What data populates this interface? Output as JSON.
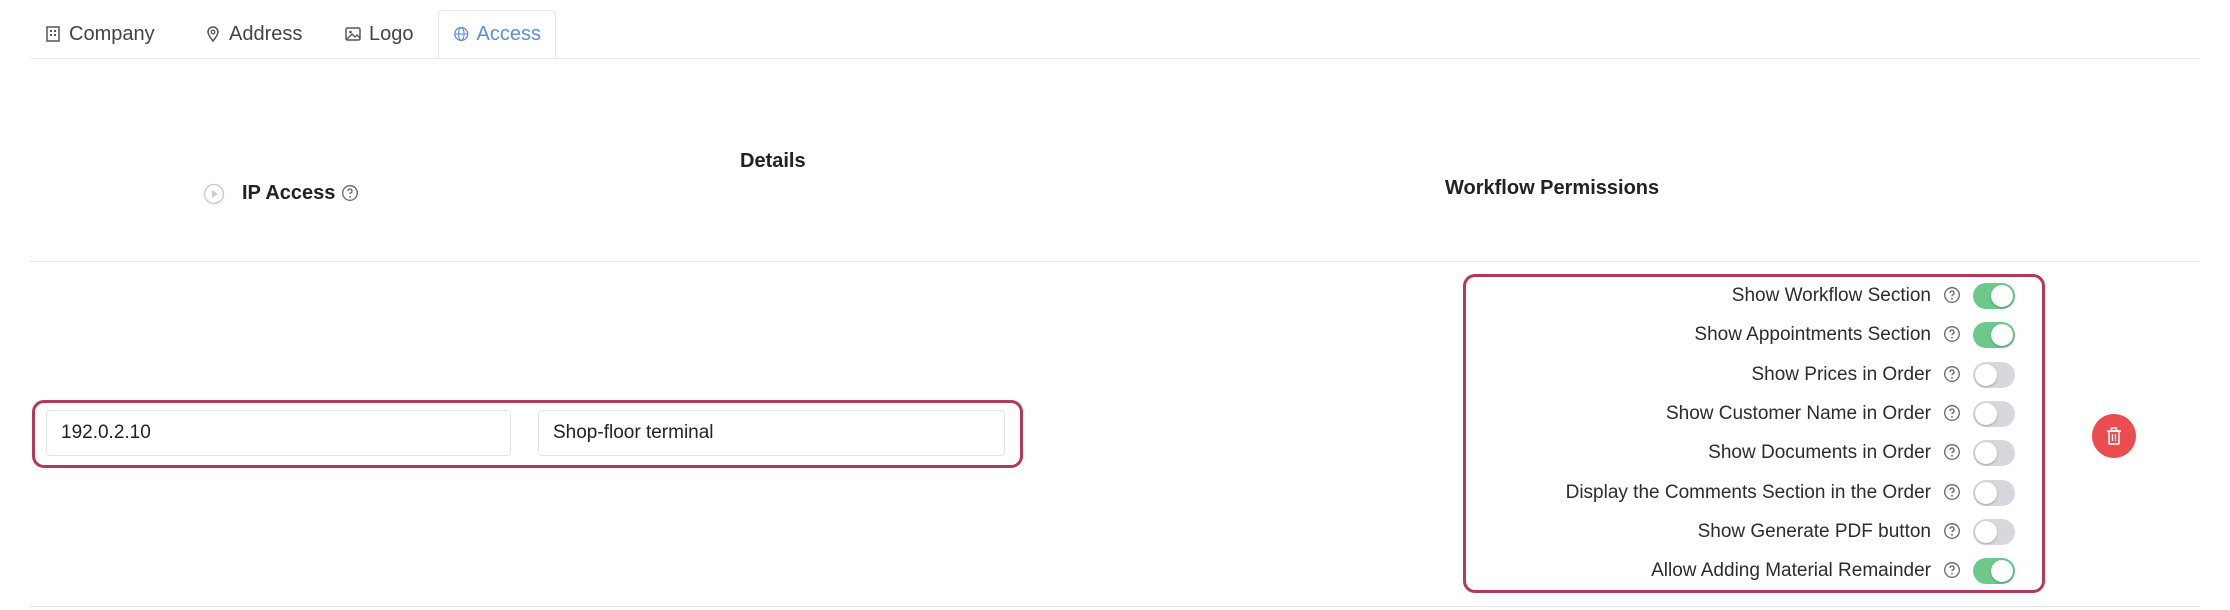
{
  "tabs": [
    {
      "label": "Company",
      "icon": "building-icon",
      "active": false
    },
    {
      "label": "Address",
      "icon": "map-pin-icon",
      "active": false
    },
    {
      "label": "Logo",
      "icon": "image-icon",
      "active": false
    },
    {
      "label": "Access",
      "icon": "globe-icon",
      "active": true
    }
  ],
  "table_header": {
    "details": "Details",
    "ip_access": "IP Access",
    "workflow_permissions": "Workflow Permissions"
  },
  "row": {
    "ip_value": "192.0.2.10",
    "details_value": "Shop-floor terminal",
    "permissions": [
      {
        "label": "Show Workflow Section",
        "enabled": true
      },
      {
        "label": "Show Appointments Section",
        "enabled": true
      },
      {
        "label": "Show Prices in Order",
        "enabled": false
      },
      {
        "label": "Show Customer Name in Order",
        "enabled": false
      },
      {
        "label": "Show Documents in Order",
        "enabled": false
      },
      {
        "label": "Display the Comments Section in the Order",
        "enabled": false
      },
      {
        "label": "Show Generate PDF button",
        "enabled": false
      },
      {
        "label": "Allow Adding Material Remainder",
        "enabled": true
      }
    ]
  },
  "colors": {
    "accent_tab": "#5b8fd8",
    "toggle_on": "#6cc88b",
    "toggle_off": "#d7d8dd",
    "delete": "#ea4c4f",
    "highlight": "#b23a56"
  }
}
